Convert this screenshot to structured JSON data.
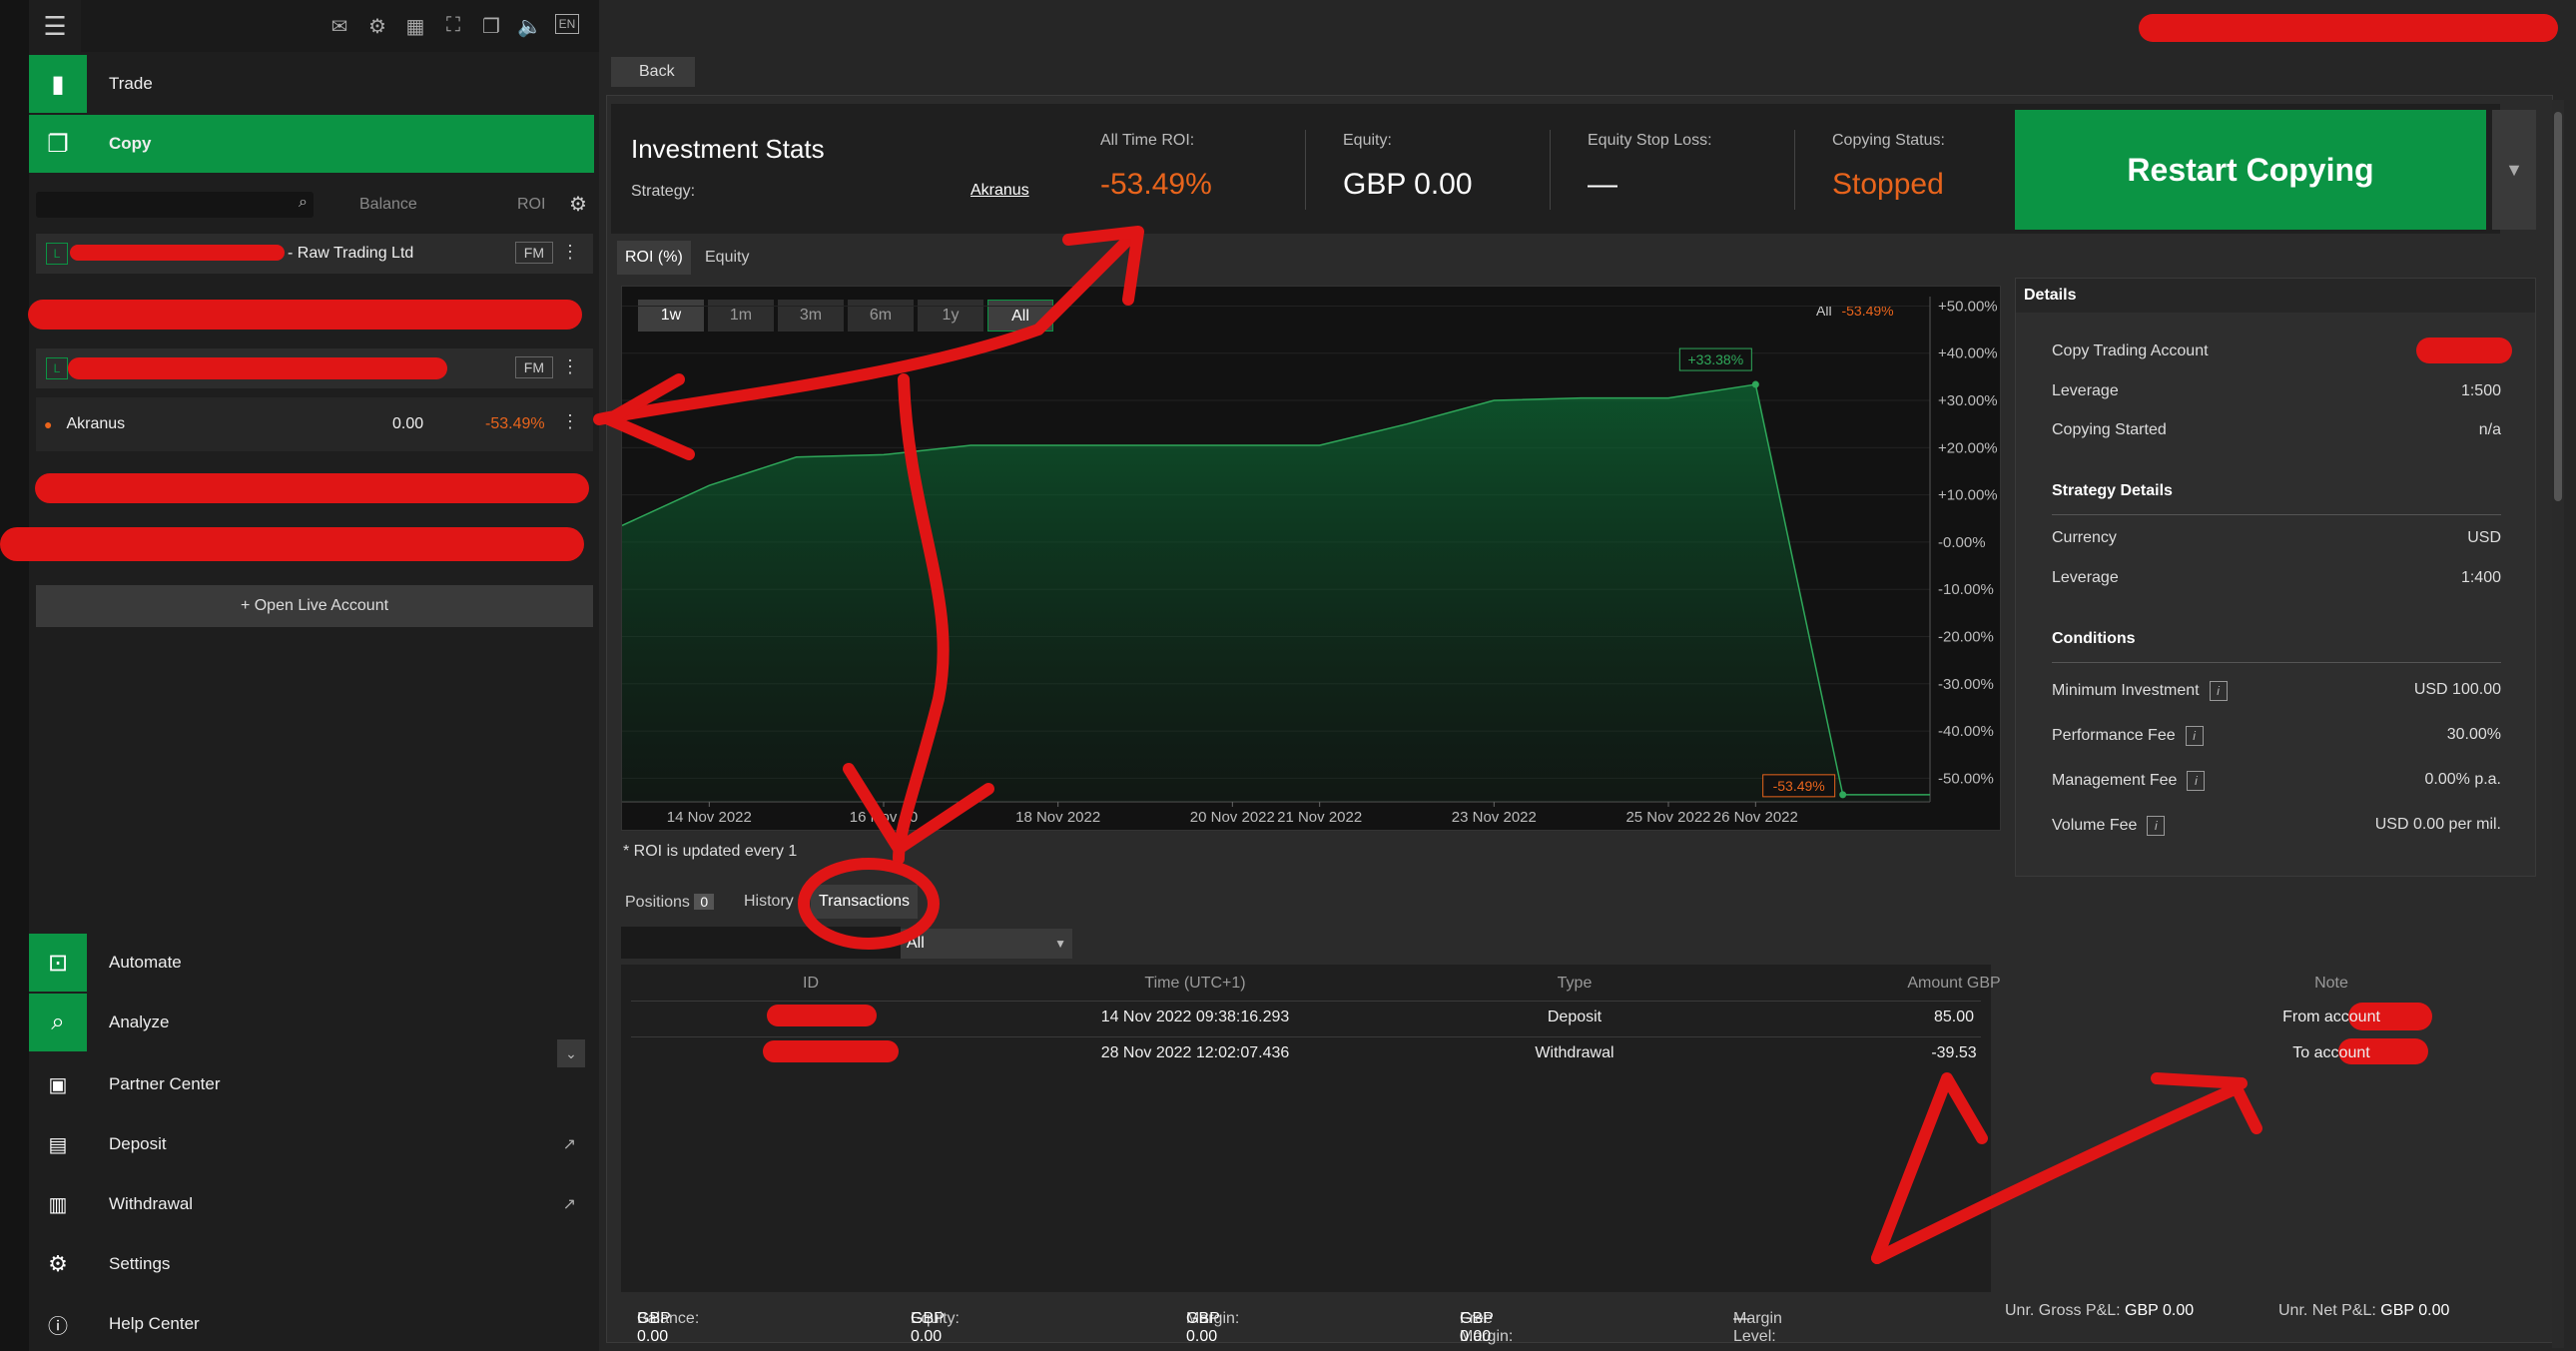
{
  "nav": {
    "trade": "Trade",
    "copy": "Copy",
    "automate": "Automate",
    "analyze": "Analyze",
    "partner": "Partner Center",
    "deposit": "Deposit",
    "withdrawal": "Withdrawal",
    "settings": "Settings",
    "help": "Help Center"
  },
  "topbar": {
    "lang": "EN"
  },
  "accounts": {
    "col_balance": "Balance",
    "col_roi": "ROI",
    "row1_name": "- Raw Trading Ltd",
    "row1_badge": "L",
    "fm": "FM",
    "row2_badge": "L",
    "akranus_name": "Akranus",
    "akranus_balance": "0.00",
    "akranus_roi": "-53.49%",
    "open_live": "+ Open Live Account"
  },
  "back": "Back",
  "stats": {
    "title": "Investment Stats",
    "strategy_label": "Strategy:",
    "strategy_value": "Akranus",
    "roi_label": "All Time ROI:",
    "roi_value": "-53.49%",
    "equity_label": "Equity:",
    "equity_value": "GBP 0.00",
    "stoploss_label": "Equity Stop Loss:",
    "stoploss_value": "—",
    "status_label": "Copying Status:",
    "status_value": "Stopped",
    "restart": "Restart Copying"
  },
  "chart_tabs": [
    "ROI (%)",
    "Equity"
  ],
  "ranges": [
    "1w",
    "1m",
    "3m",
    "6m",
    "1y",
    "All"
  ],
  "chart_legend": {
    "label": "All",
    "value": "-53.49%"
  },
  "roi_note": "* ROI is updated every 1",
  "chart_data": {
    "type": "area",
    "x": [
      "13 Nov 2022",
      "14 Nov 2022",
      "15 Nov 2022",
      "16 Nov 2022",
      "17 Nov 2022",
      "18 Nov 2022",
      "19 Nov 2022",
      "20 Nov 2022",
      "21 Nov 2022",
      "22 Nov 2022",
      "23 Nov 2022",
      "24 Nov 2022",
      "25 Nov 2022",
      "26 Nov 2022",
      "27 Nov 2022",
      "28 Nov 2022"
    ],
    "y": [
      3.5,
      12,
      18,
      18.5,
      20.5,
      20.5,
      20.5,
      20.5,
      20.5,
      25,
      30,
      30.5,
      30.5,
      33.38,
      -53.49,
      -53.49
    ],
    "annotations": [
      {
        "label": "+33.38%",
        "x": "26 Nov 2022",
        "y": 33.38
      },
      {
        "label": "-53.49%",
        "x": "27 Nov 2022",
        "y": -53.49
      }
    ],
    "xticks": [
      "14 Nov 2022",
      "16 Nov 20",
      "18 Nov 2022",
      "20 Nov 2022",
      "21 Nov 2022",
      "23 Nov 2022",
      "25 Nov 2022",
      "26 Nov 2022"
    ],
    "yticks": [
      "+50.00%",
      "+40.00%",
      "+30.00%",
      "+20.00%",
      "+10.00%",
      "-0.00%",
      "-10.00%",
      "-20.00%",
      "-30.00%",
      "-40.00%",
      "-50.00%"
    ],
    "ylim": [
      -55,
      52
    ],
    "grid": true
  },
  "details": {
    "title": "Details",
    "copy_acct": "Copy Trading Account",
    "leverage": "Leverage",
    "leverage_val": "1:500",
    "started": "Copying Started",
    "started_val": "n/a",
    "strategy_details": "Strategy Details",
    "currency": "Currency",
    "currency_val": "USD",
    "leverage2": "Leverage",
    "leverage2_val": "1:400",
    "conditions": "Conditions",
    "min_inv": "Minimum Investment",
    "min_inv_val": "USD 100.00",
    "perf_fee": "Performance Fee",
    "perf_fee_val": "30.00%",
    "mgmt_fee": "Management Fee",
    "mgmt_fee_val": "0.00% p.a.",
    "vol_fee": "Volume Fee",
    "vol_fee_val": "USD 0.00 per mil."
  },
  "bottom_tabs": {
    "positions": "Positions",
    "positions_count": "0",
    "history": "History",
    "transactions": "Transactions"
  },
  "filter": {
    "value": "All"
  },
  "table": {
    "headers": [
      "ID",
      "Time (UTC+1)",
      "Type",
      "Amount GBP",
      "Note"
    ],
    "rows": [
      {
        "time": "14 Nov 2022 09:38:16.293",
        "type": "Deposit",
        "amount": "85.00",
        "note": "From account"
      },
      {
        "time": "28 Nov 2022 12:02:07.436",
        "type": "Withdrawal",
        "amount": "-39.53",
        "note": "To account"
      }
    ]
  },
  "footer": {
    "balance_l": "Balance:",
    "balance_v": "GBP 0.00",
    "equity_l": "Equity:",
    "equity_v": "GBP 0.00",
    "margin_l": "Margin:",
    "margin_v": "GBP 0.00",
    "free_l": "Free Margin:",
    "free_v": "GBP 0.00",
    "level_l": "Margin Level:",
    "level_v": "—",
    "gross_l": "Unr. Gross P&L:",
    "gross_v": "GBP 0.00",
    "net_l": "Unr. Net P&L:",
    "net_v": "GBP 0.00"
  }
}
